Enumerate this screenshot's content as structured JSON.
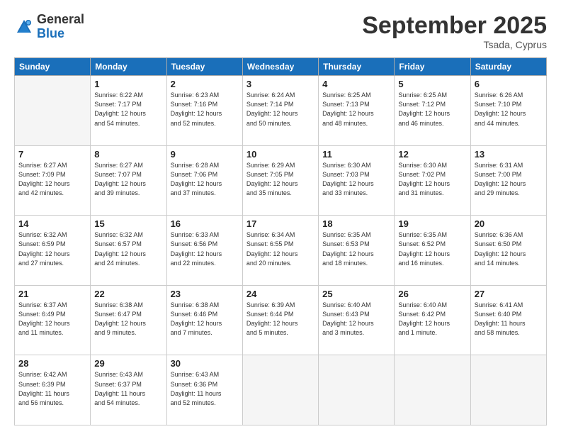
{
  "logo": {
    "general": "General",
    "blue": "Blue"
  },
  "header": {
    "month": "September 2025",
    "location": "Tsada, Cyprus"
  },
  "weekdays": [
    "Sunday",
    "Monday",
    "Tuesday",
    "Wednesday",
    "Thursday",
    "Friday",
    "Saturday"
  ],
  "weeks": [
    [
      {
        "day": "",
        "info": ""
      },
      {
        "day": "1",
        "info": "Sunrise: 6:22 AM\nSunset: 7:17 PM\nDaylight: 12 hours\nand 54 minutes."
      },
      {
        "day": "2",
        "info": "Sunrise: 6:23 AM\nSunset: 7:16 PM\nDaylight: 12 hours\nand 52 minutes."
      },
      {
        "day": "3",
        "info": "Sunrise: 6:24 AM\nSunset: 7:14 PM\nDaylight: 12 hours\nand 50 minutes."
      },
      {
        "day": "4",
        "info": "Sunrise: 6:25 AM\nSunset: 7:13 PM\nDaylight: 12 hours\nand 48 minutes."
      },
      {
        "day": "5",
        "info": "Sunrise: 6:25 AM\nSunset: 7:12 PM\nDaylight: 12 hours\nand 46 minutes."
      },
      {
        "day": "6",
        "info": "Sunrise: 6:26 AM\nSunset: 7:10 PM\nDaylight: 12 hours\nand 44 minutes."
      }
    ],
    [
      {
        "day": "7",
        "info": "Sunrise: 6:27 AM\nSunset: 7:09 PM\nDaylight: 12 hours\nand 42 minutes."
      },
      {
        "day": "8",
        "info": "Sunrise: 6:27 AM\nSunset: 7:07 PM\nDaylight: 12 hours\nand 39 minutes."
      },
      {
        "day": "9",
        "info": "Sunrise: 6:28 AM\nSunset: 7:06 PM\nDaylight: 12 hours\nand 37 minutes."
      },
      {
        "day": "10",
        "info": "Sunrise: 6:29 AM\nSunset: 7:05 PM\nDaylight: 12 hours\nand 35 minutes."
      },
      {
        "day": "11",
        "info": "Sunrise: 6:30 AM\nSunset: 7:03 PM\nDaylight: 12 hours\nand 33 minutes."
      },
      {
        "day": "12",
        "info": "Sunrise: 6:30 AM\nSunset: 7:02 PM\nDaylight: 12 hours\nand 31 minutes."
      },
      {
        "day": "13",
        "info": "Sunrise: 6:31 AM\nSunset: 7:00 PM\nDaylight: 12 hours\nand 29 minutes."
      }
    ],
    [
      {
        "day": "14",
        "info": "Sunrise: 6:32 AM\nSunset: 6:59 PM\nDaylight: 12 hours\nand 27 minutes."
      },
      {
        "day": "15",
        "info": "Sunrise: 6:32 AM\nSunset: 6:57 PM\nDaylight: 12 hours\nand 24 minutes."
      },
      {
        "day": "16",
        "info": "Sunrise: 6:33 AM\nSunset: 6:56 PM\nDaylight: 12 hours\nand 22 minutes."
      },
      {
        "day": "17",
        "info": "Sunrise: 6:34 AM\nSunset: 6:55 PM\nDaylight: 12 hours\nand 20 minutes."
      },
      {
        "day": "18",
        "info": "Sunrise: 6:35 AM\nSunset: 6:53 PM\nDaylight: 12 hours\nand 18 minutes."
      },
      {
        "day": "19",
        "info": "Sunrise: 6:35 AM\nSunset: 6:52 PM\nDaylight: 12 hours\nand 16 minutes."
      },
      {
        "day": "20",
        "info": "Sunrise: 6:36 AM\nSunset: 6:50 PM\nDaylight: 12 hours\nand 14 minutes."
      }
    ],
    [
      {
        "day": "21",
        "info": "Sunrise: 6:37 AM\nSunset: 6:49 PM\nDaylight: 12 hours\nand 11 minutes."
      },
      {
        "day": "22",
        "info": "Sunrise: 6:38 AM\nSunset: 6:47 PM\nDaylight: 12 hours\nand 9 minutes."
      },
      {
        "day": "23",
        "info": "Sunrise: 6:38 AM\nSunset: 6:46 PM\nDaylight: 12 hours\nand 7 minutes."
      },
      {
        "day": "24",
        "info": "Sunrise: 6:39 AM\nSunset: 6:44 PM\nDaylight: 12 hours\nand 5 minutes."
      },
      {
        "day": "25",
        "info": "Sunrise: 6:40 AM\nSunset: 6:43 PM\nDaylight: 12 hours\nand 3 minutes."
      },
      {
        "day": "26",
        "info": "Sunrise: 6:40 AM\nSunset: 6:42 PM\nDaylight: 12 hours\nand 1 minute."
      },
      {
        "day": "27",
        "info": "Sunrise: 6:41 AM\nSunset: 6:40 PM\nDaylight: 11 hours\nand 58 minutes."
      }
    ],
    [
      {
        "day": "28",
        "info": "Sunrise: 6:42 AM\nSunset: 6:39 PM\nDaylight: 11 hours\nand 56 minutes."
      },
      {
        "day": "29",
        "info": "Sunrise: 6:43 AM\nSunset: 6:37 PM\nDaylight: 11 hours\nand 54 minutes."
      },
      {
        "day": "30",
        "info": "Sunrise: 6:43 AM\nSunset: 6:36 PM\nDaylight: 11 hours\nand 52 minutes."
      },
      {
        "day": "",
        "info": ""
      },
      {
        "day": "",
        "info": ""
      },
      {
        "day": "",
        "info": ""
      },
      {
        "day": "",
        "info": ""
      }
    ]
  ]
}
